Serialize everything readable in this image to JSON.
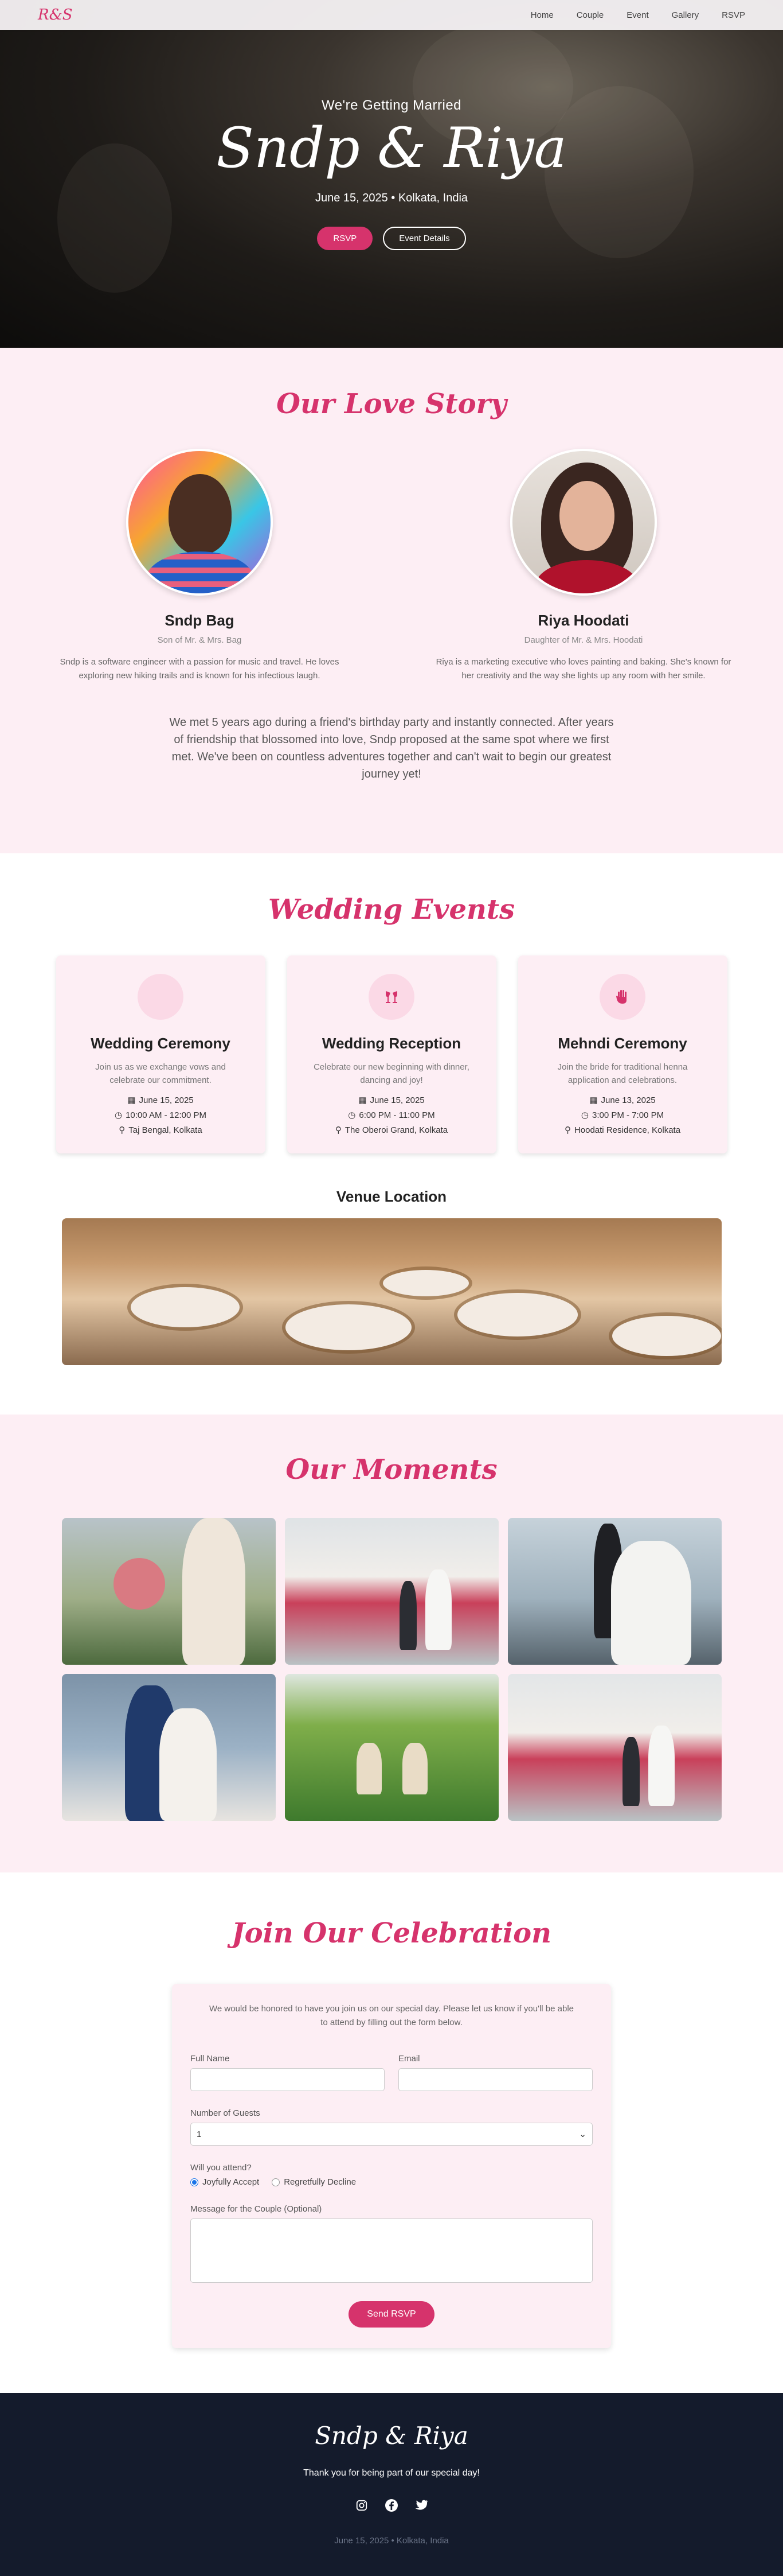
{
  "nav": {
    "logo": "R&S",
    "links": [
      "Home",
      "Couple",
      "Event",
      "Gallery",
      "RSVP"
    ]
  },
  "hero": {
    "subtitle": "We're Getting Married",
    "names": "Sndp & Riya",
    "date_location": "June 15, 2025 • Kolkata, India",
    "rsvp_button": "RSVP",
    "details_button": "Event Details"
  },
  "love_story": {
    "title": "Our Love Story",
    "groom": {
      "name": "Sndp Bag",
      "parents": "Son of Mr. & Mrs. Bag",
      "bio": "Sndp is a software engineer with a passion for music and travel. He loves exploring new hiking trails and is known for his infectious laugh."
    },
    "bride": {
      "name": "Riya Hoodati",
      "parents": "Daughter of Mr. & Mrs. Hoodati",
      "bio": "Riya is a marketing executive who loves painting and baking. She's known for her creativity and the way she lights up any room with her smile."
    },
    "story": "We met 5 years ago during a friend's birthday party and instantly connected. After years of friendship that blossomed into love, Sndp proposed at the same spot where we first met. We've been on countless adventures together and can't wait to begin our greatest journey yet!"
  },
  "events": {
    "title": "Wedding Events",
    "items": [
      {
        "icon": "rings-icon",
        "title": "Wedding Ceremony",
        "desc": "Join us as we exchange vows and celebrate our commitment.",
        "date": "June 15, 2025",
        "time": "10:00 AM - 12:00 PM",
        "venue": "Taj Bengal, Kolkata"
      },
      {
        "icon": "glasses-cheers-icon",
        "title": "Wedding Reception",
        "desc": "Celebrate our new beginning with dinner, dancing and joy!",
        "date": "June 15, 2025",
        "time": "6:00 PM - 11:00 PM",
        "venue": "The Oberoi Grand, Kolkata"
      },
      {
        "icon": "hand-henna-icon",
        "title": "Mehndi Ceremony",
        "desc": "Join the bride for traditional henna application and celebrations.",
        "date": "June 13, 2025",
        "time": "3:00 PM - 7:00 PM",
        "venue": "Hoodati Residence, Kolkata"
      }
    ],
    "venue_title": "Venue Location"
  },
  "moments": {
    "title": "Our Moments"
  },
  "rsvp": {
    "title": "Join Our Celebration",
    "intro": "We would be honored to have you join us on our special day. Please let us know if you'll be able to attend by filling out the form below.",
    "name_label": "Full Name",
    "name_value": "",
    "email_label": "Email",
    "email_value": "",
    "guests_label": "Number of Guests",
    "guests_value": "1",
    "attend_label": "Will you attend?",
    "attend_yes": "Joyfully Accept",
    "attend_no": "Regretfully Decline",
    "attend_selected": "yes",
    "message_label": "Message for the Couple (Optional)",
    "submit": "Send RSVP"
  },
  "footer": {
    "names": "Sndp & Riya",
    "thanks": "Thank you for being part of our special day!",
    "socials": [
      "instagram-icon",
      "facebook-icon",
      "twitter-icon"
    ],
    "bottom": "June 15, 2025 • Kolkata, India"
  },
  "colors": {
    "accent": "#d6336c",
    "light_pink": "#fdeef4",
    "footer_bg": "#141b2c"
  }
}
